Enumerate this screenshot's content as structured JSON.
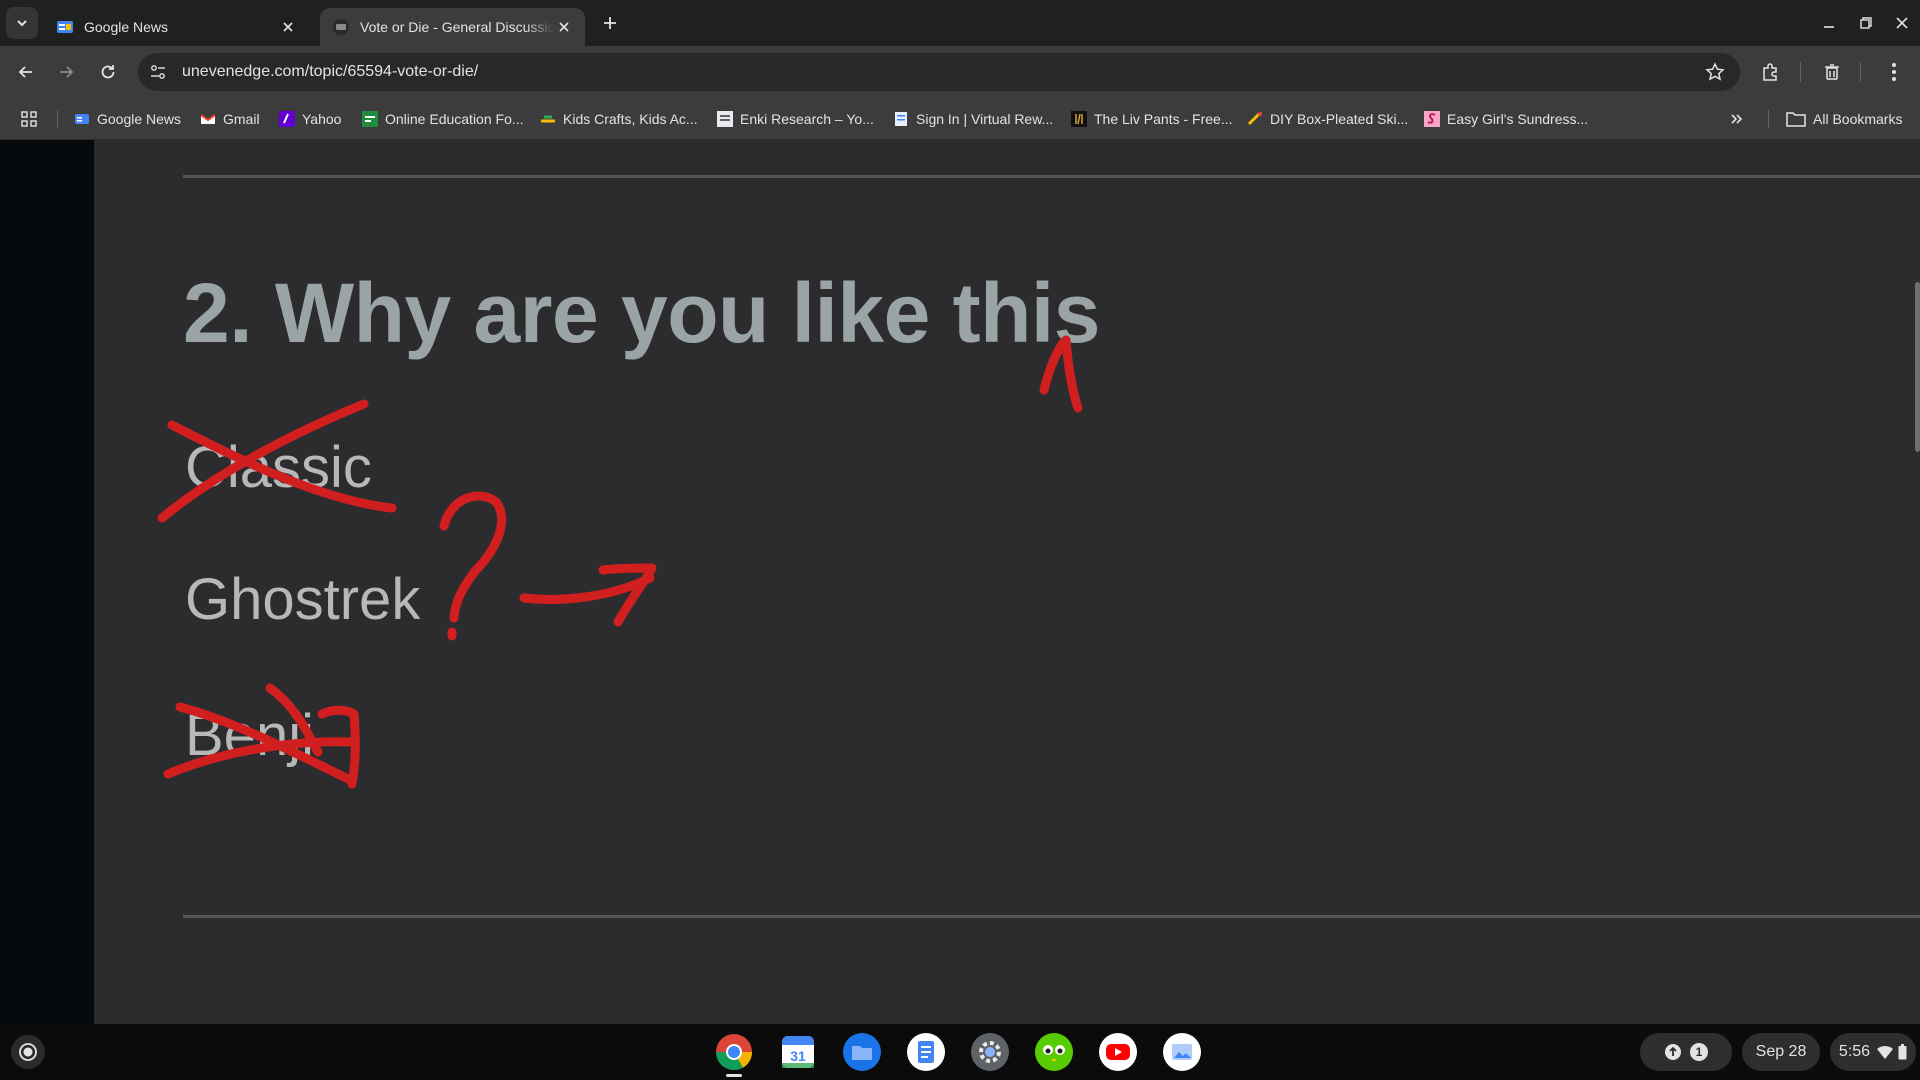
{
  "tabs": [
    {
      "title": "Google News",
      "icon": "google-news-icon",
      "active": false
    },
    {
      "title": "Vote or Die - General Discussion",
      "icon": "forum-icon",
      "active": true
    }
  ],
  "address_bar": {
    "url": "unevenedge.com/topic/65594-vote-or-die/"
  },
  "bookmarks": [
    {
      "label": "Google News",
      "icon": "google-news-icon"
    },
    {
      "label": "Gmail",
      "icon": "gmail-icon"
    },
    {
      "label": "Yahoo",
      "icon": "yahoo-icon"
    },
    {
      "label": "Online Education Fo...",
      "icon": "education-icon"
    },
    {
      "label": "Kids Crafts, Kids Ac...",
      "icon": "crafts-icon"
    },
    {
      "label": "Enki Research – Yo...",
      "icon": "enki-icon"
    },
    {
      "label": "Sign In | Virtual Rew...",
      "icon": "rewards-icon"
    },
    {
      "label": "The Liv Pants - Free...",
      "icon": "liv-icon"
    },
    {
      "label": "DIY Box-Pleated Ski...",
      "icon": "diy-icon"
    },
    {
      "label": "Easy Girl's Sundress...",
      "icon": "sundress-icon"
    }
  ],
  "all_bookmarks_label": "All Bookmarks",
  "content": {
    "heading": "2. Why are you like this",
    "options": [
      "Classic",
      "Ghostrek",
      "Benji"
    ]
  },
  "shelf": {
    "apps": [
      "chrome-icon",
      "calendar-icon",
      "files-icon",
      "docs-icon",
      "settings-icon",
      "duolingo-icon",
      "youtube-icon",
      "gallery-icon"
    ],
    "calendar_day": "31",
    "notification_count": "1",
    "date": "Sep 28",
    "time": "5:56"
  },
  "colors": {
    "page_bg": "#2c2c2e",
    "heading": "#9aa4a4",
    "annotation_red": "#d11f1f"
  }
}
